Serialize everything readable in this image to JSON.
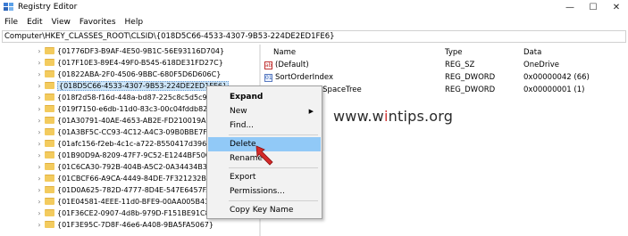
{
  "window": {
    "title": "Registry Editor",
    "controls": [
      "—",
      "☐",
      "✕"
    ]
  },
  "menu": [
    "File",
    "Edit",
    "View",
    "Favorites",
    "Help"
  ],
  "address": "Computer\\HKEY_CLASSES_ROOT\\CLSID\\{018D5C66-4533-4307-9B53-224DE2ED1FE6}",
  "tree": {
    "items": [
      "{01776DF3-B9AF-4E50-9B1C-56E93116D704}",
      "{017F10E3-89E4-49F0-B545-618DE31FD27C}",
      "{01822ABA-2F0-4506-9BBC-680F5D6D606C}",
      "{018D5C66-4533-4307-9B53-224DE2ED1FE6}",
      "{018f2d58-f16d-448a-bd87-225c8c5d5c94}",
      "{019f7150-e6db-11d0-83c3-00c04fddb82e}",
      "{01A30791-40AE-4653-AB2E-FD210019AE88}",
      "{01A3BF5C-CC93-4C12-A4C3-09B0BBE7F63}",
      "{01afc156-f2eb-4c1c-a722-8550417d396f}",
      "{01B90D9A-8209-47F7-9C52-E1244BF50CED}",
      "{01C6CA30-792B-404B-A5C2-0A34434B3AA}",
      "{01CBCF66-A9CA-4449-84DE-7F321232B8E}",
      "{01D0A625-782D-4777-8D4E-547E6457FAD5}",
      "{01E04581-4EEE-11d0-BFE9-00AA005B4383}",
      "{01F36CE2-0907-4d8b-979D-F151BE91C883}",
      "{01F3E95C-7D8F-46e6-A408-9BA5FA5067}"
    ],
    "selected_index": 3
  },
  "values": {
    "headers": {
      "name": "Name",
      "type": "Type",
      "data": "Data"
    },
    "rows": [
      {
        "icon": "string-value-icon",
        "badge": "ab",
        "name": "(Default)",
        "type": "REG_SZ",
        "data": "OneDrive"
      },
      {
        "icon": "dword-value-icon",
        "badge": "01",
        "name": "SortOrderIndex",
        "type": "REG_DWORD",
        "data": "0x00000042 (66)"
      },
      {
        "icon": "dword-value-icon",
        "badge": "01",
        "name": "…edToNameSpaceTree",
        "type": "REG_DWORD",
        "data": "0x00000001 (1)"
      }
    ]
  },
  "context_menu": {
    "items": [
      {
        "label": "Expand",
        "bold": true
      },
      {
        "label": "New",
        "submenu": true
      },
      {
        "label": "Find..."
      },
      {
        "label": "Delete",
        "highlighted": true
      },
      {
        "label": "Rename"
      },
      {
        "label": "Export"
      },
      {
        "label": "Permissions..."
      },
      {
        "label": "Copy Key Name"
      }
    ],
    "submenu_arrow": "▶"
  },
  "watermark": {
    "pre": "www.w",
    "i": "i",
    "post": "ntips.org"
  },
  "colors": {
    "highlight": "#91c9f7",
    "folder": "#f3cb5e",
    "arrow": "#d42a2a"
  }
}
